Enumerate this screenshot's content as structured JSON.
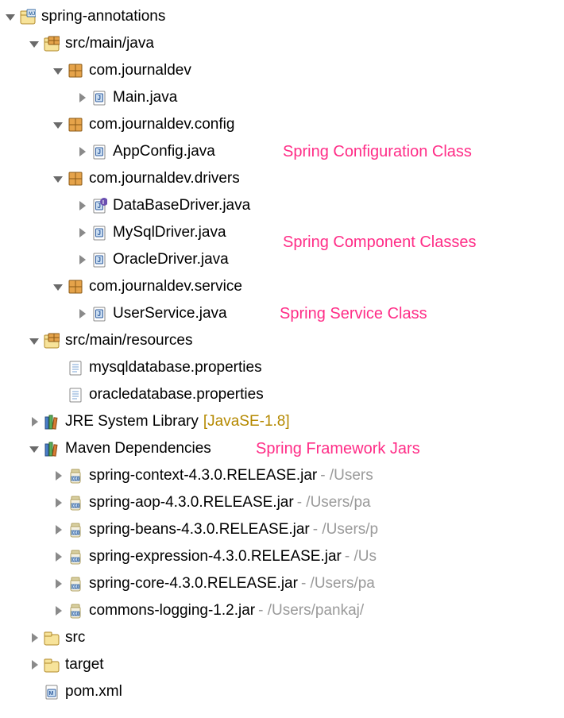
{
  "project": {
    "name": "spring-annotations"
  },
  "srcMainJava": {
    "label": "src/main/java"
  },
  "pkg1": {
    "label": "com.journaldev"
  },
  "pkg1_files": {
    "main": "Main.java"
  },
  "pkg2": {
    "label": "com.journaldev.config"
  },
  "pkg2_files": {
    "appconfig": "AppConfig.java"
  },
  "pkg3": {
    "label": "com.journaldev.drivers"
  },
  "pkg3_files": {
    "db": "DataBaseDriver.java",
    "mysql": "MySqlDriver.java",
    "oracle": "OracleDriver.java"
  },
  "pkg4": {
    "label": "com.journaldev.service"
  },
  "pkg4_files": {
    "userservice": "UserService.java"
  },
  "srcMainResources": {
    "label": "src/main/resources"
  },
  "resources": {
    "mysql": "mysqldatabase.properties",
    "oracle": "oracledatabase.properties"
  },
  "jre": {
    "label": "JRE System Library",
    "suffix": "[JavaSE-1.8]"
  },
  "maven": {
    "label": "Maven Dependencies"
  },
  "jars": {
    "context": {
      "name": "spring-context-4.3.0.RELEASE.jar",
      "path": " - /Users"
    },
    "aop": {
      "name": "spring-aop-4.3.0.RELEASE.jar",
      "path": " - /Users/pa"
    },
    "beans": {
      "name": "spring-beans-4.3.0.RELEASE.jar",
      "path": " - /Users/p"
    },
    "expression": {
      "name": "spring-expression-4.3.0.RELEASE.jar",
      "path": " - /Us"
    },
    "core": {
      "name": "spring-core-4.3.0.RELEASE.jar",
      "path": " - /Users/pa"
    },
    "logging": {
      "name": "commons-logging-1.2.jar",
      "path": " - /Users/pankaj/"
    }
  },
  "src": {
    "label": "src"
  },
  "target": {
    "label": "target"
  },
  "pom": {
    "label": "pom.xml"
  },
  "annotations": {
    "config": "Spring Configuration Class",
    "component": "Spring Component Classes",
    "service": "Spring Service Class",
    "jars": "Spring Framework Jars"
  }
}
